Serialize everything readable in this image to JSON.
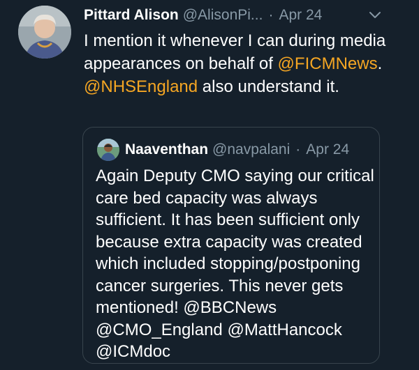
{
  "tweet": {
    "author_name": "Pittard Alison",
    "author_handle": "@AlisonPi...",
    "separator": "·",
    "date": "Apr 24",
    "menu_icon": "chevron-down-icon",
    "avatar_icon": "user-avatar",
    "text_parts": {
      "before": "I mention it whenever I can during media appearances on behalf of ",
      "mention1": "@FICMNews",
      "middle": ". ",
      "mention2": "@NHSEngland",
      "after": " also understand it."
    },
    "mention_color": "#f5a623"
  },
  "quote": {
    "author_name": "Naaventhan",
    "author_handle": "@navpalani",
    "separator": "·",
    "date": "Apr 24",
    "avatar_icon": "user-avatar",
    "lines": [
      "Again Deputy CMO saying our critical",
      "care bed capacity was always",
      "sufficient. It has been sufficient only",
      "because extra capacity was created",
      "which included stopping/postponing",
      "cancer surgeries. This never gets",
      "mentioned! @BBCNews",
      "@CMO_England @MattHancock",
      "@ICMdoc"
    ]
  },
  "colors": {
    "background": "#15202b",
    "border": "#38444d",
    "secondary_text": "#8899a6"
  }
}
